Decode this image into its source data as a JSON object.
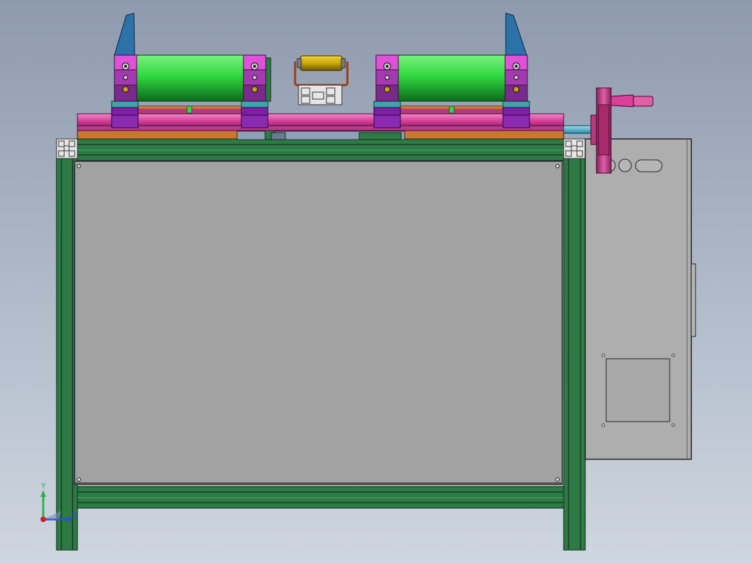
{
  "view": {
    "type": "3D CAD model — front orthographic view"
  },
  "triad": {
    "y_label": "Y",
    "z_label": "Z",
    "colors": {
      "x": "#d0202a",
      "y": "#2bb34a",
      "z": "#2a4fd6"
    }
  },
  "colors": {
    "frame_green": "#2d7a45",
    "frame_dark": "#1d4a2c",
    "panel_gray": "#a2a2a2",
    "cabinet_gray": "#aeaeae",
    "roller_green": "#2fd93f",
    "block_pink": "#e050d8",
    "block_purple": "#7d1fa5",
    "rail_magenta": "#d9409a",
    "bracket_blue": "#2a72a8",
    "teal": "#3aa6a8",
    "handwheel": "#c83a86",
    "guide_yellow": "#c8a80a",
    "plate_orange": "#c87830"
  }
}
